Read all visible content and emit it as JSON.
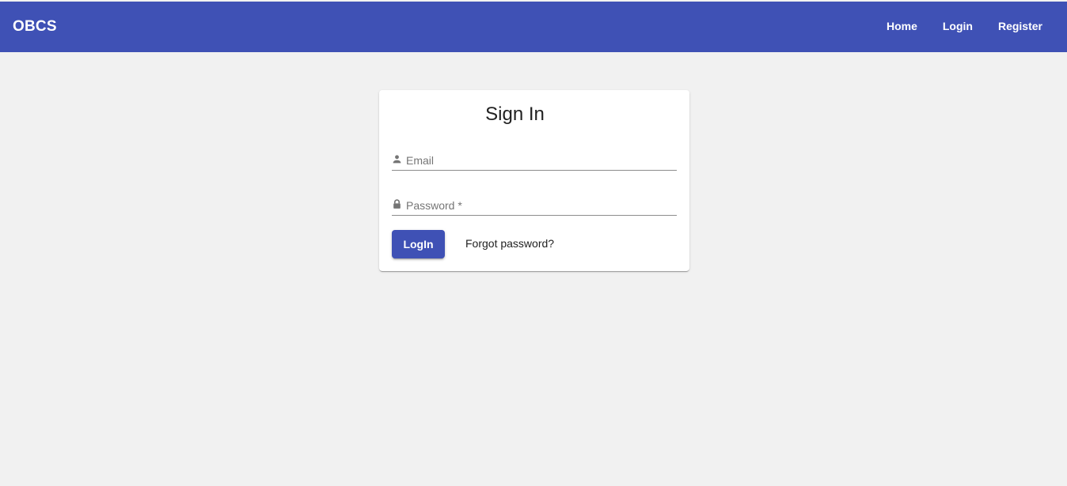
{
  "app": {
    "brand": "OBCS"
  },
  "nav": {
    "items": [
      "Home",
      "Login",
      "Register"
    ]
  },
  "signin": {
    "title": "Sign In",
    "email_label": "Email",
    "password_label": "Password *",
    "login_button": "LogIn",
    "forgot_link": "Forgot password?"
  },
  "colors": {
    "primary": "#3f51b5",
    "background": "#f1f1f1",
    "card": "#ffffff"
  },
  "icons": {
    "email": "person-icon",
    "password": "lock-icon"
  }
}
